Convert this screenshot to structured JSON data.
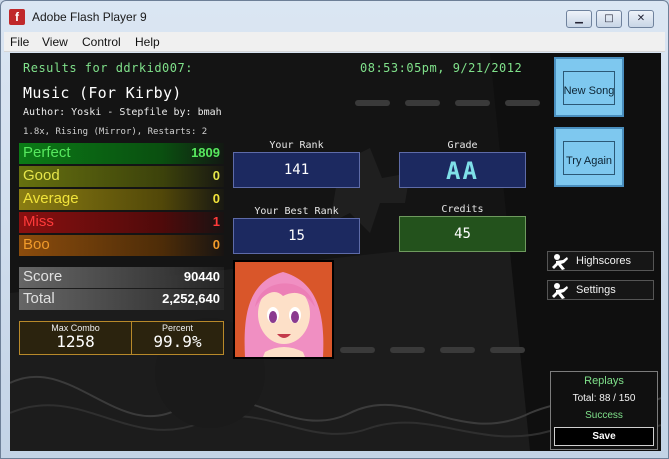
{
  "window": {
    "title": "Adobe Flash Player 9",
    "min_glyph": "▁",
    "max_glyph": "□",
    "close_glyph": "✕",
    "icon": "flash-icon"
  },
  "menu": [
    "File",
    "View",
    "Control",
    "Help"
  ],
  "results": {
    "header": "Results for ddrkid007:",
    "timestamp": "08:53:05pm, 9/21/2012",
    "song": "Music (For Kirby)",
    "author": "Author: Yoski   -   Stepfile by: bmah",
    "mods": "1.8x, Rising (Mirror), Restarts: 2"
  },
  "judgements": [
    {
      "label": "Perfect",
      "value": "1809",
      "color": "#57e85e"
    },
    {
      "label": "Good",
      "value": "0",
      "color": "#e6e64a"
    },
    {
      "label": "Average",
      "value": "0",
      "color": "#f1e33a"
    },
    {
      "label": "Miss",
      "value": "1",
      "color": "#ff3a3a"
    },
    {
      "label": "Boo",
      "value": "0",
      "color": "#f09a2a"
    }
  ],
  "score": {
    "label": "Score",
    "value": "90440"
  },
  "total": {
    "label": "Total",
    "value": "2,252,640"
  },
  "max_combo": {
    "label": "Max Combo",
    "value": "1258"
  },
  "percent": {
    "label": "Percent",
    "value": "99.9%"
  },
  "your_rank": {
    "label": "Your Rank",
    "value": "141"
  },
  "best_rank": {
    "label": "Your Best Rank",
    "value": "15"
  },
  "grade": {
    "label": "Grade",
    "value": "AA"
  },
  "credits": {
    "label": "Credits",
    "value": "45"
  },
  "buttons": {
    "new_song": "New Song",
    "try_again": "Try Again",
    "highscores": "Highscores",
    "settings": "Settings"
  },
  "replays": {
    "title": "Replays",
    "total": "Total: 88 / 150",
    "status": "Success",
    "save": "Save"
  },
  "colors": {
    "accent_green": "#7fe08a",
    "rank_blue": "#1c2960",
    "credits_green": "#23521c",
    "side_button": "#7ec8ef"
  }
}
